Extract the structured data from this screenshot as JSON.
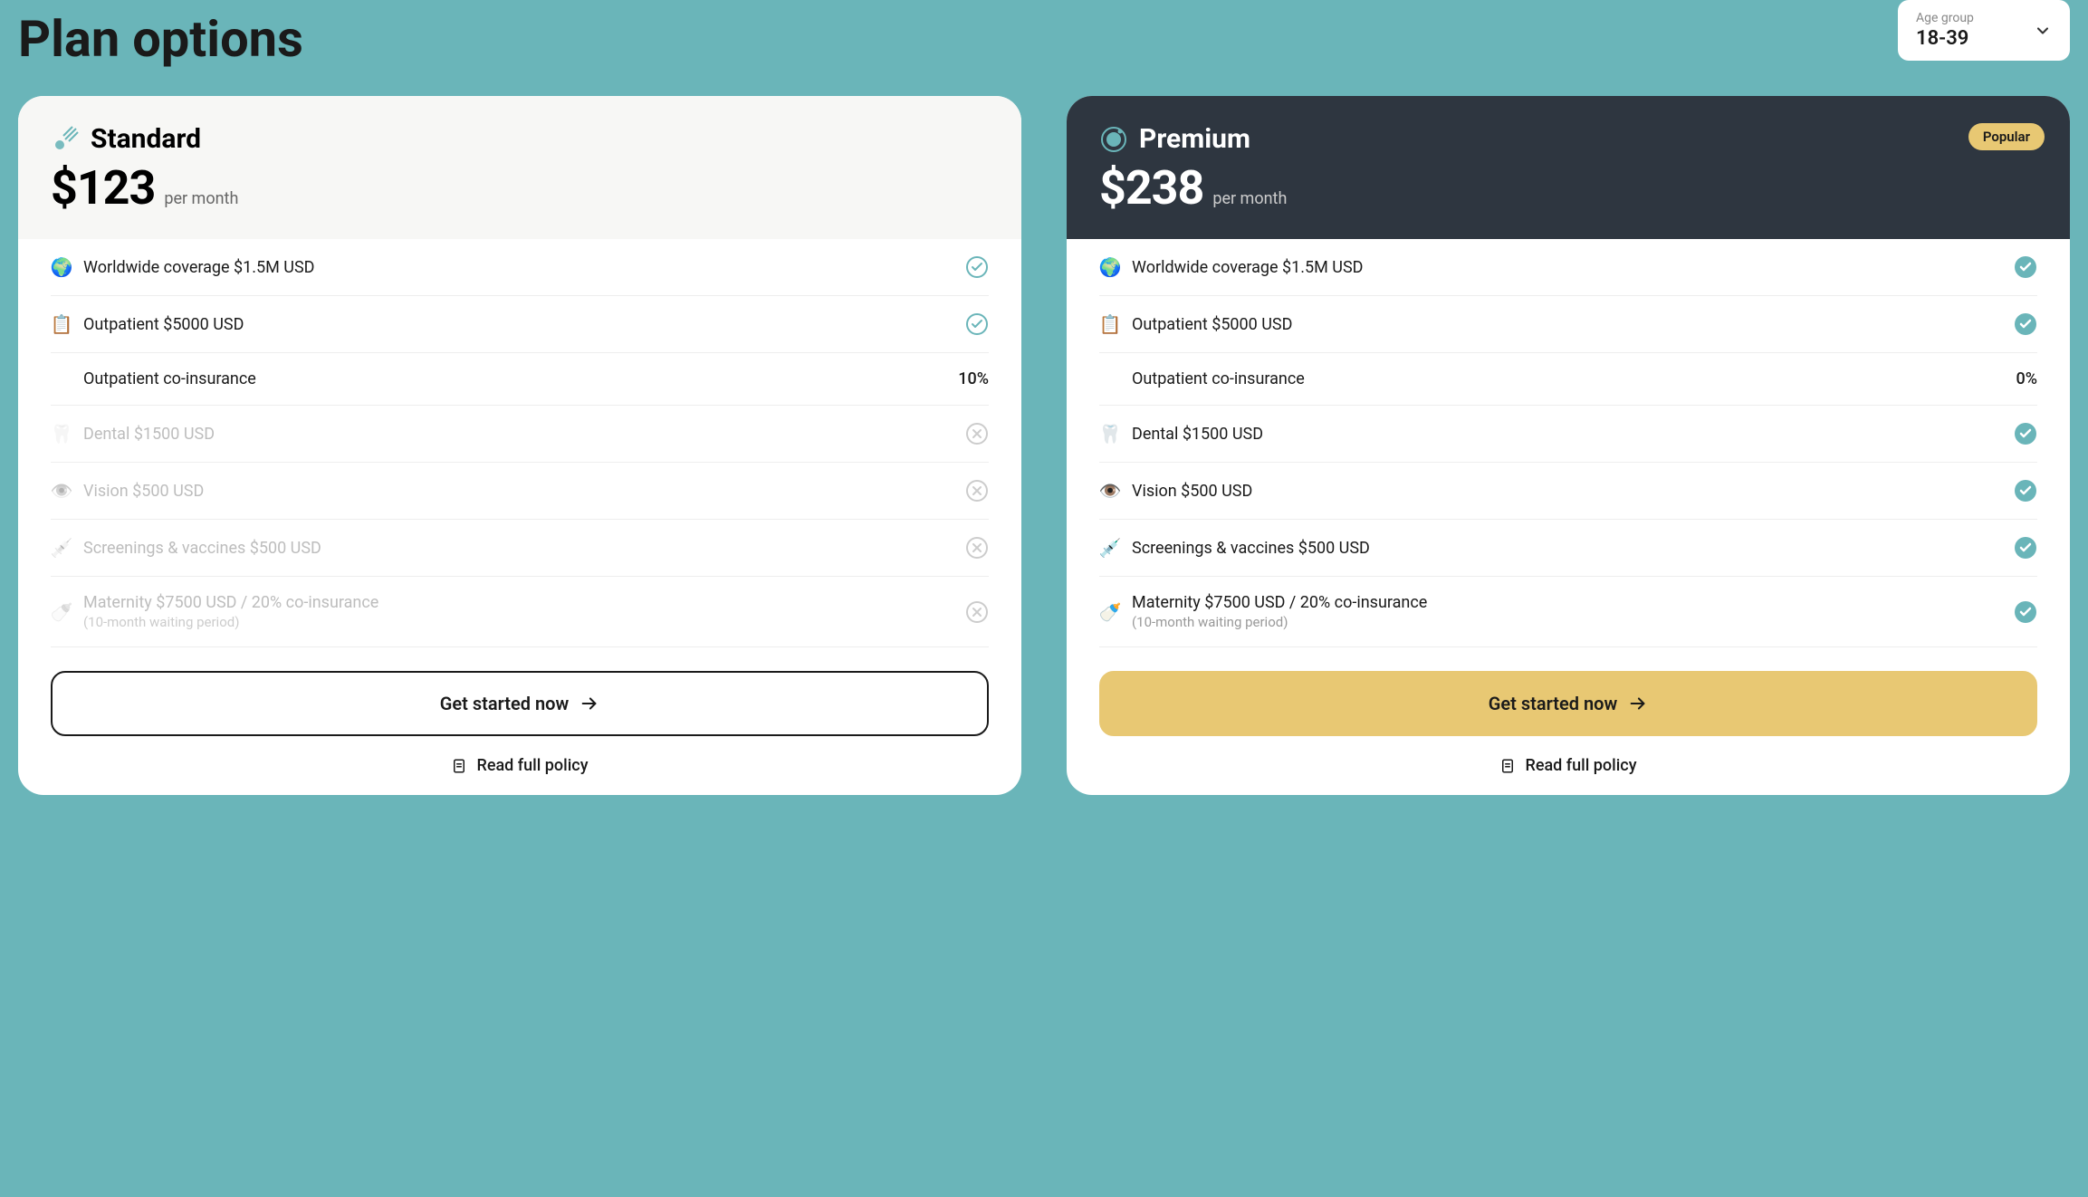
{
  "page_title": "Plan options",
  "age_group": {
    "label": "Age group",
    "value": "18-39"
  },
  "popular_badge": "Popular",
  "plans": [
    {
      "id": "standard",
      "name": "Standard",
      "price": "$123",
      "period": "per month",
      "popular": false,
      "header_dark": false,
      "features": [
        {
          "icon": "globe",
          "label": "Worldwide coverage $1.5M USD",
          "status": "check_outline"
        },
        {
          "icon": "clipboard",
          "label": "Outpatient $5000 USD",
          "status": "check_outline"
        },
        {
          "indent": true,
          "label": "Outpatient co-insurance",
          "value": "10%"
        },
        {
          "icon": "tooth",
          "label": "Dental $1500 USD",
          "status": "x",
          "disabled": true
        },
        {
          "icon": "eye",
          "label": "Vision $500 USD",
          "status": "x",
          "disabled": true
        },
        {
          "icon": "shield",
          "label": "Screenings & vaccines $500 USD",
          "status": "x",
          "disabled": true
        },
        {
          "icon": "baby",
          "label": "Maternity $7500 USD / 20% co-insurance",
          "sublabel": "(10-month waiting period)",
          "status": "x",
          "disabled": true
        }
      ],
      "cta": "Get started now",
      "cta_style": "outline",
      "policy_link": "Read full policy"
    },
    {
      "id": "premium",
      "name": "Premium",
      "price": "$238",
      "period": "per month",
      "popular": true,
      "header_dark": true,
      "features": [
        {
          "icon": "globe",
          "label": "Worldwide coverage $1.5M USD",
          "status": "check_fill"
        },
        {
          "icon": "clipboard",
          "label": "Outpatient $5000 USD",
          "status": "check_fill"
        },
        {
          "indent": true,
          "label": "Outpatient co-insurance",
          "value": "0%"
        },
        {
          "icon": "tooth",
          "label": "Dental $1500 USD",
          "status": "check_fill"
        },
        {
          "icon": "eye",
          "label": "Vision $500 USD",
          "status": "check_fill"
        },
        {
          "icon": "shield",
          "label": "Screenings & vaccines $500 USD",
          "status": "check_fill"
        },
        {
          "icon": "baby",
          "label": "Maternity $7500 USD / 20% co-insurance",
          "sublabel": "(10-month waiting period)",
          "status": "check_fill"
        }
      ],
      "cta": "Get started now",
      "cta_style": "primary",
      "policy_link": "Read full policy"
    }
  ]
}
